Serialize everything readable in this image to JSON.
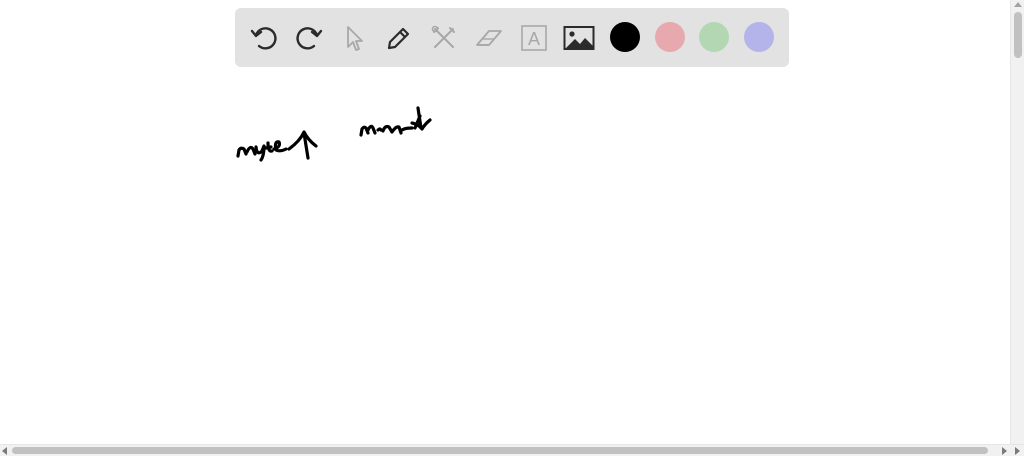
{
  "toolbar": {
    "tools": [
      {
        "name": "undo-icon",
        "enabled": true
      },
      {
        "name": "redo-icon",
        "enabled": true
      },
      {
        "name": "pointer-icon",
        "enabled": false
      },
      {
        "name": "pen-icon",
        "enabled": true
      },
      {
        "name": "tools-icon",
        "enabled": false
      },
      {
        "name": "eraser-icon",
        "enabled": false
      },
      {
        "name": "text-icon",
        "enabled": false
      },
      {
        "name": "image-icon",
        "enabled": true
      }
    ],
    "text_tool_glyph": "A",
    "colors": {
      "black": "#000000",
      "pink": "#e8a9ae",
      "green": "#b3d7b3",
      "lavender": "#b4b4ea"
    }
  },
  "palette": {
    "toolbar_bg": "#e2e2e2",
    "icon_active": "#2b2b2b",
    "icon_disabled": "#a8a8a8",
    "ink": "#000000"
  }
}
